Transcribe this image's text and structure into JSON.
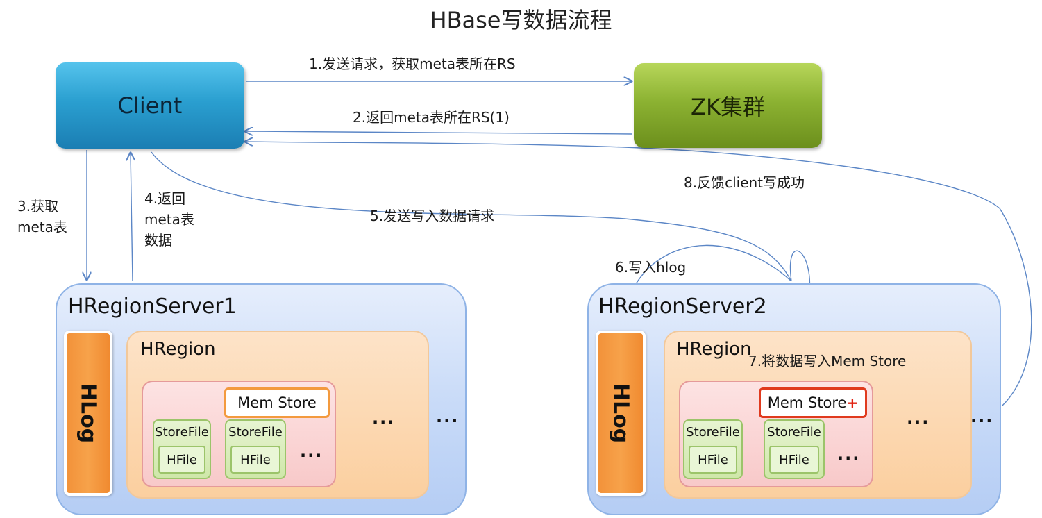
{
  "title": "HBase写数据流程",
  "nodes": {
    "client": "Client",
    "zk": "ZK集群"
  },
  "edges": {
    "step1": "1.发送请求，获取meta表所在RS",
    "step2": "2.返回meta表所在RS(1)",
    "step3": [
      "3.获取",
      "meta表"
    ],
    "step4": [
      "4.返回",
      "meta表",
      "数据"
    ],
    "step5": "5.发送写入数据请求",
    "step6": "6.写入hlog",
    "step7": "7.将数据写入Mem Store",
    "step8": "8.反馈client写成功"
  },
  "servers": [
    {
      "name": "HRegionServer1",
      "hlog": "HLog",
      "region": "HRegion",
      "memstore": "Mem Store",
      "storefiles": [
        {
          "label": "StoreFile",
          "hfile": "HFile"
        },
        {
          "label": "StoreFile",
          "hfile": "HFile"
        }
      ],
      "store_more": "...",
      "region_more": "...",
      "server_more": "..."
    },
    {
      "name": "HRegionServer2",
      "hlog": "HLog",
      "region": "HRegion",
      "memstore": "Mem Store",
      "storefiles": [
        {
          "label": "StoreFile",
          "hfile": "HFile"
        },
        {
          "label": "StoreFile",
          "hfile": "HFile"
        }
      ],
      "store_more": "...",
      "region_more": "...",
      "server_more": "..."
    }
  ],
  "colors": {
    "arrow": "#5b86c6",
    "client": "#2a9fd0",
    "zk": "#8cb232",
    "memstore_highlight": "#e03a1e"
  }
}
